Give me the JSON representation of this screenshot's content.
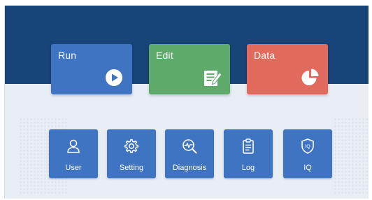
{
  "main_actions": [
    {
      "label": "Run",
      "icon": "play-icon"
    },
    {
      "label": "Edit",
      "icon": "edit-document-icon"
    },
    {
      "label": "Data",
      "icon": "pie-chart-icon"
    }
  ],
  "tiles": [
    {
      "label": "User",
      "icon": "user-icon"
    },
    {
      "label": "Setting",
      "icon": "gear-icon"
    },
    {
      "label": "Diagnosis",
      "icon": "diagnosis-icon"
    },
    {
      "label": "Log",
      "icon": "clipboard-icon"
    },
    {
      "label": "IQ",
      "icon": "shield-icon",
      "icon_text": "IQ"
    }
  ],
  "colors": {
    "header": "#17457a",
    "background": "#e9eef5",
    "run": "#3e74c2",
    "edit": "#5eaa6a",
    "data": "#e16a5c",
    "tile": "#3e74c2"
  }
}
